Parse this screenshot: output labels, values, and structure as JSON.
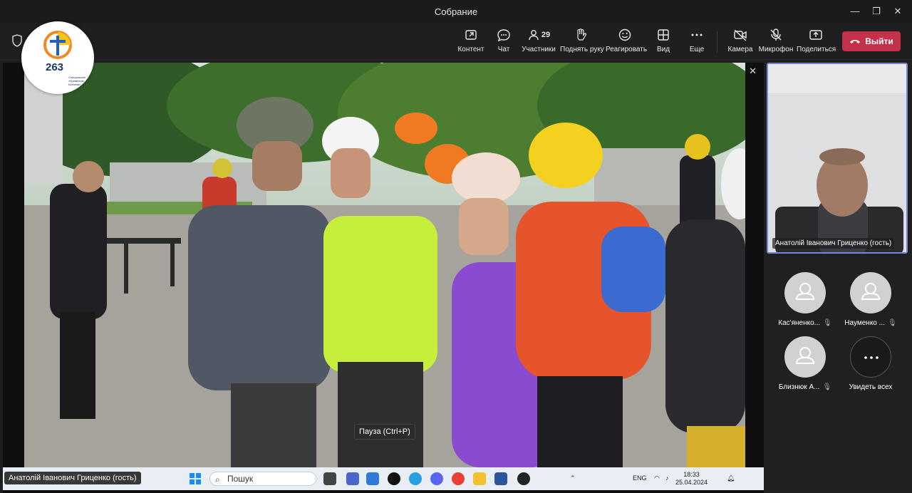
{
  "window": {
    "title": "Собрание",
    "min": "—",
    "max": "❐",
    "close": "✕"
  },
  "toolbar": {
    "content": "Контент",
    "chat": "Чат",
    "participants": "Участники",
    "participants_count": "29",
    "raise_hand": "Поднять руку",
    "react": "Реагировать",
    "view": "Вид",
    "more": "Еще",
    "camera": "Камера",
    "mic": "Микрофон",
    "share": "Поделиться",
    "leave": "Выйти",
    "accent": "#c4314b"
  },
  "logo": {
    "number": "263",
    "subtitle": "Спеціальний «Кревельно Безпеки»"
  },
  "stage": {
    "tooltip": "Пауза (Ctrl+P)",
    "presenter_tag": "Анатолій Іванович Гриценко (гость)"
  },
  "taskbar": {
    "search": "Пошук",
    "lang": "ENG",
    "time": "18:33",
    "date": "25.04.2024"
  },
  "right_panel": {
    "self_caption": "Анатолій Іванович Гриценко (гость)",
    "participants": [
      {
        "name": "Кас'яненко..."
      },
      {
        "name": "Науменко ..."
      },
      {
        "name": "Близнюк А..."
      }
    ],
    "see_all": "Увидеть всех",
    "selection_color": "#7c83d8"
  }
}
